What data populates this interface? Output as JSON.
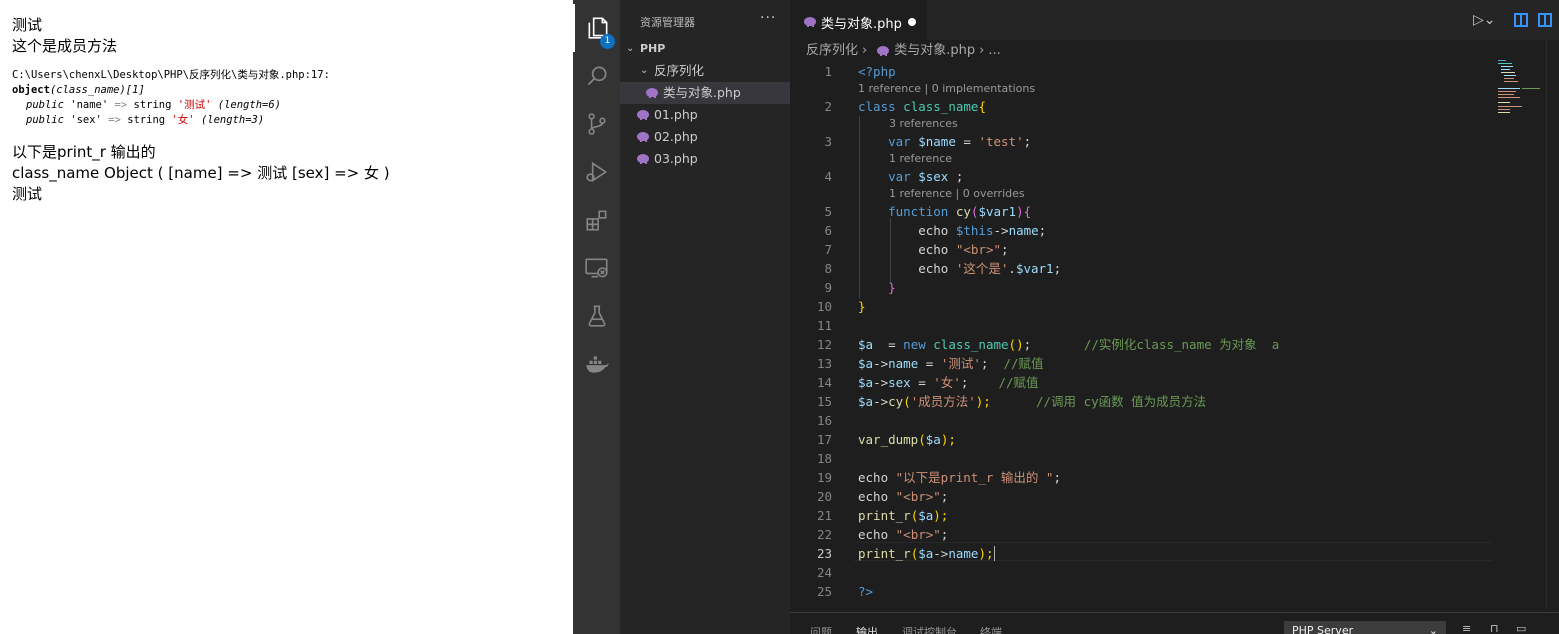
{
  "browser": {
    "line1": "测试",
    "line2": "这个是成员方法",
    "dump_path": "C:\\Users\\chenxL\\Desktop\\PHP\\反序列化\\类与对象.php:17:",
    "dump_object": "object",
    "dump_class": "(class_name)",
    "dump_id": "[1]",
    "prop1_vis": "public",
    "prop1_key": "'name'",
    "prop1_arrow": "=>",
    "prop1_type": "string",
    "prop1_val": "'测试'",
    "prop1_len": "(length=6)",
    "prop2_vis": "public",
    "prop2_key": "'sex'",
    "prop2_arrow": "=>",
    "prop2_type": "string",
    "prop2_val": "'女'",
    "prop2_len": "(length=3)",
    "line3": "以下是print_r 输出的",
    "line4": "class_name Object ( [name] => 测试 [sex] => 女 )",
    "line5": "测试"
  },
  "activity_bar": {
    "items": [
      "explorer-icon",
      "search-icon",
      "source-control-icon",
      "run-debug-icon",
      "extensions-icon",
      "remote-explorer-icon",
      "testing-icon",
      "docker-icon"
    ],
    "explorer_badge": "1"
  },
  "sidebar": {
    "title": "资源管理器",
    "more": "···",
    "root": "PHP",
    "folder": "反序列化",
    "files": [
      "类与对象.php",
      "01.php",
      "02.php",
      "03.php"
    ]
  },
  "editor": {
    "tab_label": "类与对象.php",
    "breadcrumb": [
      "反序列化",
      "类与对象.php",
      "..."
    ],
    "lens": {
      "l1": "1 reference | 0 implementations",
      "l2": "3 references",
      "l3": "1 reference",
      "l4": "1 reference | 0 overrides"
    },
    "line_numbers": [
      "1",
      "2",
      "3",
      "4",
      "5",
      "6",
      "7",
      "8",
      "9",
      "10",
      "11",
      "12",
      "13",
      "14",
      "15",
      "16",
      "17",
      "18",
      "19",
      "20",
      "21",
      "22",
      "23",
      "24",
      "25"
    ],
    "current_line": "23",
    "code": {
      "l1": "<?php",
      "l2_kw": "class",
      "l2_name": "class_name",
      "l2_brace": "{",
      "l3_kw": "var",
      "l3_var": "$name",
      "l3_eq": " = ",
      "l3_str": "'test'",
      "l3_end": ";",
      "l4_kw": "var",
      "l4_var": "$sex",
      "l4_end": " ;",
      "l5_kw": "function",
      "l5_fn": "cy",
      "l5_open": "(",
      "l5_var": "$var1",
      "l5_close": "){",
      "l6_kw": "echo",
      "l6_this": "$this",
      "l6_arrow": "->",
      "l6_prop": "name",
      "l6_end": ";",
      "l7_kw": "echo",
      "l7_str": "\"<br>\"",
      "l7_end": ";",
      "l8_kw": "echo",
      "l8_str": "'这个是'",
      "l8_dot": ".",
      "l8_var": "$var1",
      "l8_end": ";",
      "l9": "}",
      "l10": "}",
      "l12_var": "$a",
      "l12_eq": "  = ",
      "l12_new": "new",
      "l12_cls": "class_name",
      "l12_paren": "()",
      "l12_end": ";",
      "l12_comment": "//实例化class_name 为对象  a",
      "l13_var": "$a",
      "l13_arrow": "->",
      "l13_prop": "name",
      "l13_eq": " = ",
      "l13_str": "'测试'",
      "l13_end": ";",
      "l13_comment": "//赋值",
      "l14_var": "$a",
      "l14_arrow": "->",
      "l14_prop": "sex",
      "l14_eq": " = ",
      "l14_str": "'女'",
      "l14_end": ";",
      "l14_comment": "//赋值",
      "l15_var": "$a",
      "l15_arrow": "->",
      "l15_fn": "cy",
      "l15_open": "(",
      "l15_str": "'成员方法'",
      "l15_close": ");",
      "l15_comment": "//调用 cy函数 值为成员方法",
      "l17_fn": "var_dump",
      "l17_open": "(",
      "l17_var": "$a",
      "l17_close": ");",
      "l19_kw": "echo",
      "l19_str": "\"以下是print_r 输出的 \"",
      "l19_end": ";",
      "l20_kw": "echo",
      "l20_str": "\"<br>\"",
      "l20_end": ";",
      "l21_fn": "print_r",
      "l21_open": "(",
      "l21_var": "$a",
      "l21_close": ");",
      "l22_kw": "echo",
      "l22_str": "\"<br>\"",
      "l22_end": ";",
      "l23_fn": "print_r",
      "l23_open": "(",
      "l23_var": "$a",
      "l23_arrow": "->",
      "l23_prop": "name",
      "l23_close": ");",
      "l25": "?>"
    }
  },
  "panel": {
    "tabs": [
      "问题",
      "输出",
      "调试控制台",
      "终端"
    ],
    "active_tab": "输出",
    "channel": "PHP Server"
  },
  "colors": {
    "activity_bar": "#333333",
    "sidebar": "#252526",
    "editor_bg": "#1e1e1e",
    "accent_blue": "#0e70c0",
    "php_icon": "#a074c4"
  }
}
